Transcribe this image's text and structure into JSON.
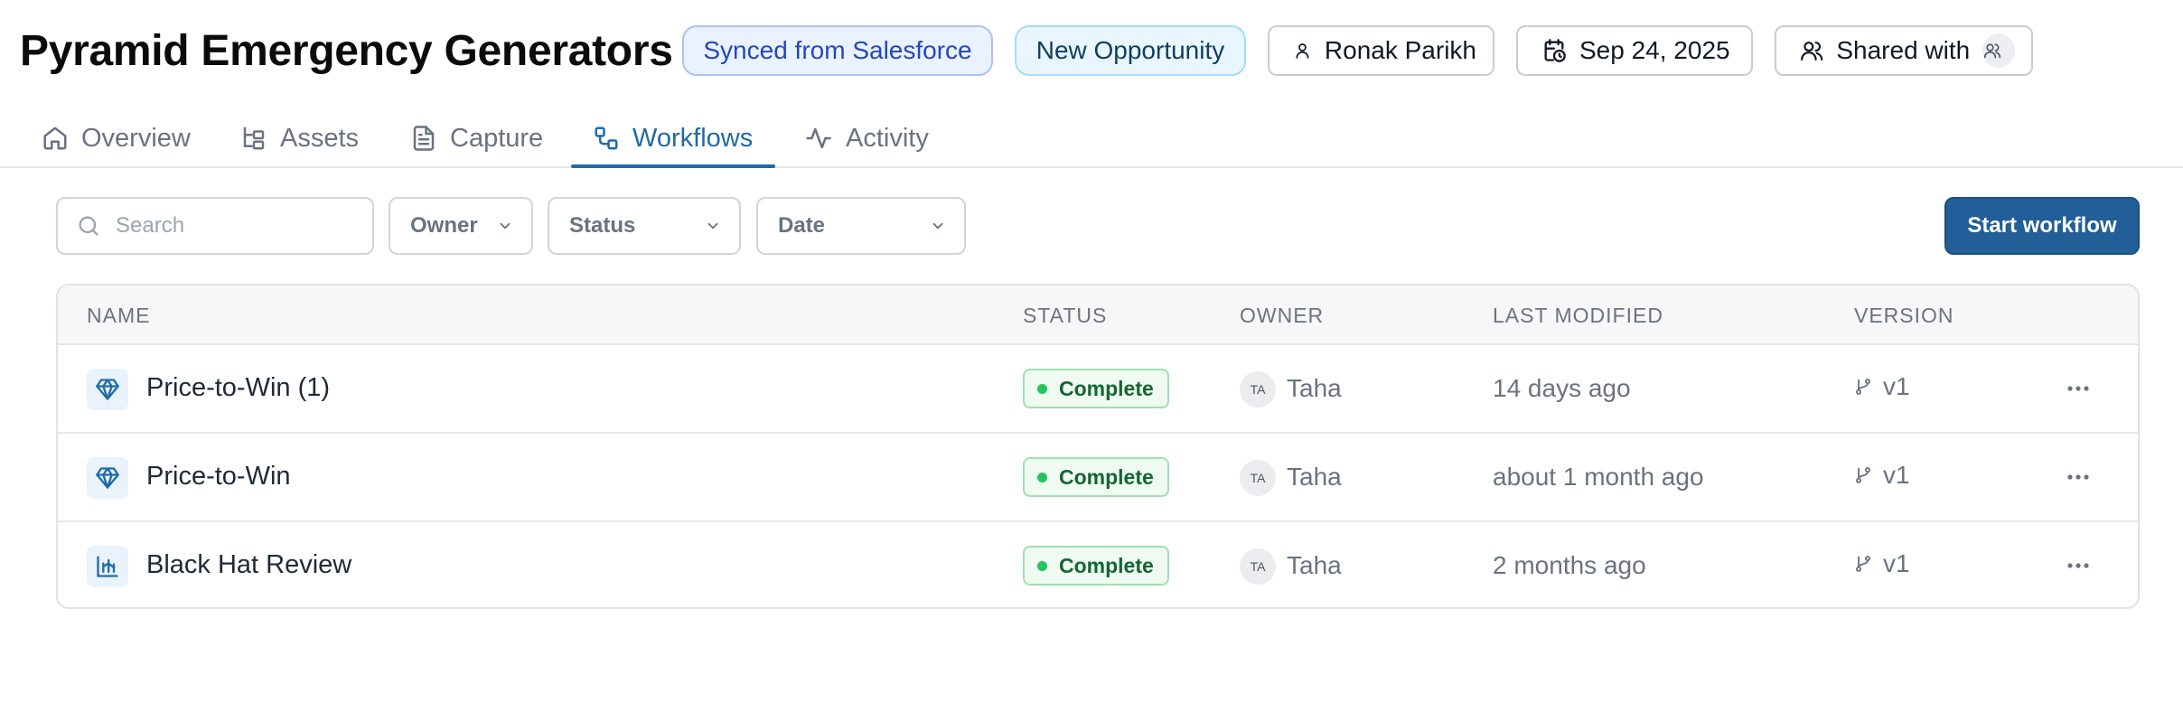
{
  "header": {
    "title": "Pyramid Emergency Generators",
    "sync_badge": "Synced from Salesforce",
    "stage_badge": "New Opportunity",
    "owner": "Ronak Parikh",
    "date": "Sep 24, 2025",
    "shared_label": "Shared with"
  },
  "tabs": [
    {
      "label": "Overview",
      "icon": "home-icon"
    },
    {
      "label": "Assets",
      "icon": "tree-icon"
    },
    {
      "label": "Capture",
      "icon": "document-icon"
    },
    {
      "label": "Workflows",
      "icon": "workflow-icon",
      "active": true
    },
    {
      "label": "Activity",
      "icon": "activity-icon"
    }
  ],
  "filters": {
    "search_placeholder": "Search",
    "owner": "Owner",
    "status": "Status",
    "date": "Date",
    "start_button": "Start workflow"
  },
  "table": {
    "columns": [
      "NAME",
      "STATUS",
      "OWNER",
      "LAST MODIFIED",
      "VERSION"
    ],
    "rows": [
      {
        "name": "Price-to-Win (1)",
        "icon": "diamond-icon",
        "status": "Complete",
        "owner_initials": "TA",
        "owner": "Taha",
        "modified": "14 days ago",
        "version": "v1"
      },
      {
        "name": "Price-to-Win",
        "icon": "diamond-icon",
        "status": "Complete",
        "owner_initials": "TA",
        "owner": "Taha",
        "modified": "about 1 month ago",
        "version": "v1"
      },
      {
        "name": "Black Hat Review",
        "icon": "chart-icon",
        "status": "Complete",
        "owner_initials": "TA",
        "owner": "Taha",
        "modified": "2 months ago",
        "version": "v1"
      }
    ]
  },
  "colors": {
    "accent": "#1f6ba8",
    "primary_button": "#225e97",
    "status_complete": "#22c55e"
  }
}
